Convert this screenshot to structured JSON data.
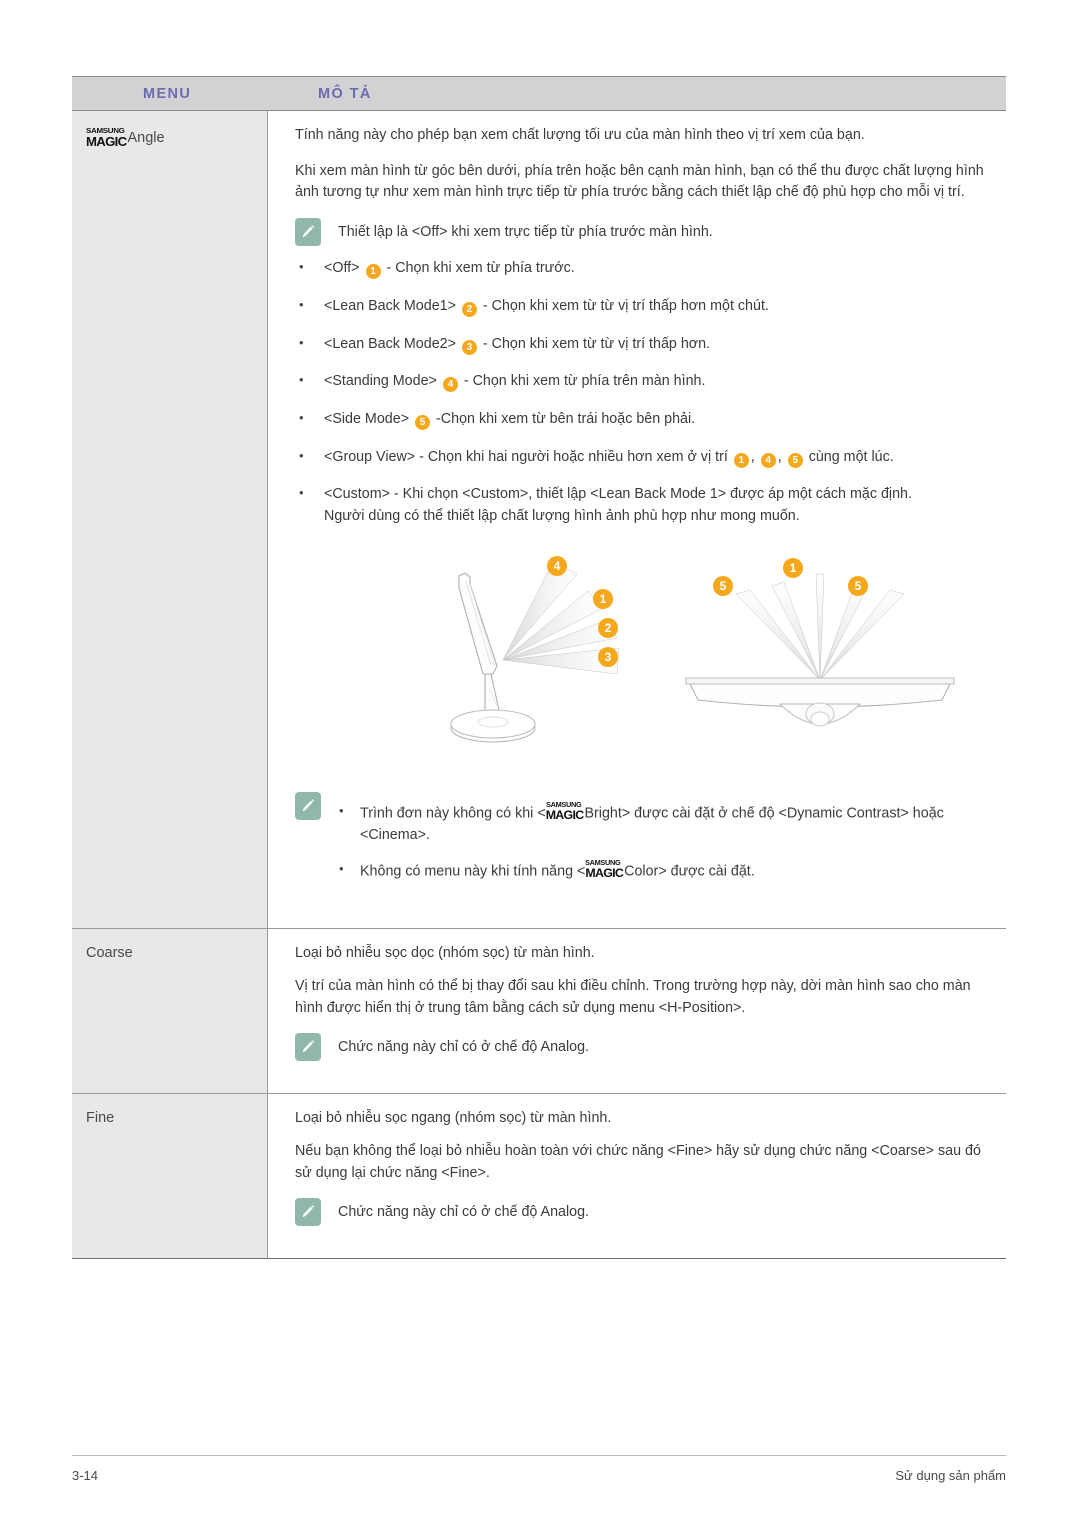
{
  "table": {
    "headers": {
      "menu": "MENU",
      "description": "MÔ TẢ"
    },
    "accent_header_text_color": "#6b6bb0",
    "header_bg": "#d2d2d4",
    "menu_cell_bg": "#e8e8e8",
    "badge_color": "#f5a81c",
    "note_icon_color": "#8fb8a8"
  },
  "row_angle": {
    "menu_logo": {
      "top": "SAMSUNG",
      "bottom": "MAGIC"
    },
    "menu_label": "Angle",
    "paragraphs": [
      "Tính năng này cho phép bạn xem chất lượng tối ưu của màn hình theo vị trí xem của bạn.",
      "Khi xem màn hình từ góc bên dưới, phía trên hoặc bên cạnh màn hình, bạn có thể thu được chất lượng hình ảnh tương tự như xem màn hình trực tiếp từ phía trước bằng cách thiết lập chế độ phù hợp cho mỗi vị trí."
    ],
    "note_top": "Thiết lập là <Off> khi xem trực tiếp từ phía trước màn hình.",
    "options": [
      {
        "name": "<Off>",
        "badge": "1",
        "desc": "- Chọn khi xem từ phía trước."
      },
      {
        "name": "<Lean Back Mode1>",
        "badge": "2",
        "desc": "- Chọn khi xem từ từ vị trí thấp hơn một chút."
      },
      {
        "name": "<Lean Back Mode2>",
        "badge": "3",
        "desc": "- Chọn khi xem từ từ vị trí thấp hơn."
      },
      {
        "name": "<Standing Mode>",
        "badge": "4",
        "desc": "- Chọn khi xem từ phía trên màn hình."
      },
      {
        "name": "<Side Mode>",
        "badge": "5",
        "desc": "-Chọn khi xem từ bên trái hoặc bên phải."
      }
    ],
    "group_view": {
      "prefix": "<Group View> - Chọn khi hai người hoặc nhiều hơn xem ở vị trí",
      "badges": [
        "1",
        "4",
        "5"
      ],
      "suffix": "cùng một lúc."
    },
    "custom": {
      "line1": "<Custom> - Khi chọn <Custom>, thiết lập <Lean Back Mode 1> được áp một cách mặc định.",
      "line2": "Người dùng có thể thiết lập chất lượng hình ảnh phù hợp như mong muốn."
    },
    "figure": {
      "left_diagram_badges": [
        "4",
        "1",
        "2",
        "3"
      ],
      "right_diagram_badges": [
        "5",
        "1",
        "5"
      ],
      "left_caption": "side-view monitor viewing angle diagram",
      "right_caption": "top-view monitor viewing angle diagram"
    },
    "notes_bottom": [
      {
        "prefix": "Trình đơn này không có khi <",
        "logo": {
          "top": "SAMSUNG",
          "bottom": "MAGIC"
        },
        "suffix": "Bright> được cài đặt ở chế độ <Dynamic Contrast> hoặc <Cinema>."
      },
      {
        "prefix": "Không có menu này khi tính năng <",
        "logo": {
          "top": "SAMSUNG",
          "bottom": "MAGIC"
        },
        "suffix": "Color> được cài đặt."
      }
    ]
  },
  "row_coarse": {
    "menu_label": "Coarse",
    "paragraphs": [
      "Loại bỏ nhiễu sọc dọc (nhóm sọc) từ màn hình.",
      "Vị trí của màn hình có thể bị thay đổi sau khi điều chỉnh. Trong trường hợp này, dời màn hình sao cho màn hình được hiển thị ở trung tâm bằng cách sử dụng menu <H-Position>."
    ],
    "note": "Chức năng này chỉ có ở chế độ Analog."
  },
  "row_fine": {
    "menu_label": "Fine",
    "paragraphs": [
      "Loại bỏ nhiễu sọc ngang (nhóm sọc) từ màn hình.",
      "Nếu bạn không thể loại bỏ nhiễu hoàn toàn với chức năng <Fine> hãy sử dụng chức năng <Coarse> sau đó sử dụng lại chức năng <Fine>."
    ],
    "note": "Chức năng này chỉ có ở chế độ Analog."
  },
  "footer": {
    "page_number": "3-14",
    "section_title": "Sử dụng sản phẩm"
  }
}
